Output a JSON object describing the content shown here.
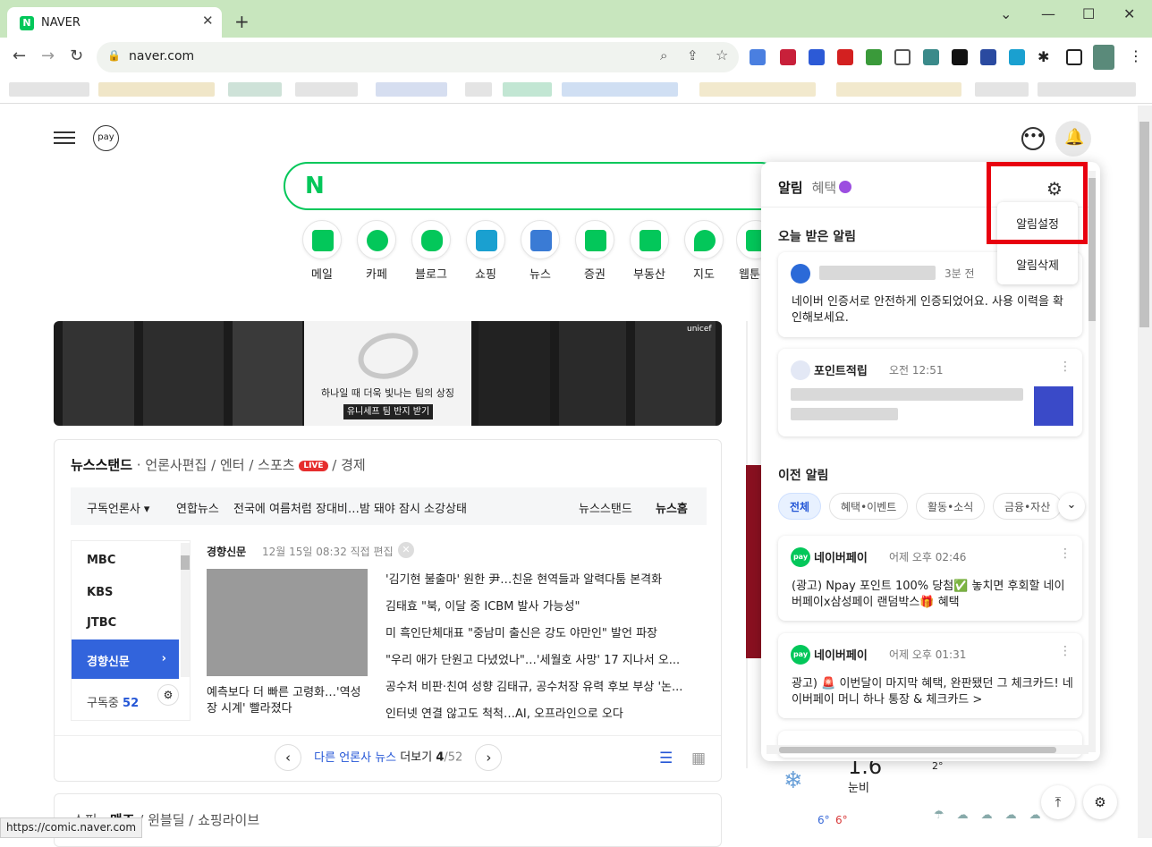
{
  "browser": {
    "tab_title": "NAVER",
    "favicon": "N",
    "url": "naver.com"
  },
  "header": {
    "pay": "pay",
    "talk": "•••",
    "bell": "🔔"
  },
  "search": {
    "logo": "N"
  },
  "services": [
    "메일",
    "카페",
    "블로그",
    "쇼핑",
    "뉴스",
    "증권",
    "부동산",
    "지도",
    "웹툰"
  ],
  "banner": {
    "line1": "하나일 때 더욱 빛나는 팀의 상징",
    "button": "유니세프 팀 반지 받기",
    "brand": "unicef"
  },
  "news": {
    "tabs": [
      "뉴스스탠드",
      "언론사편집",
      "엔터",
      "스포츠",
      "경제"
    ],
    "live": "LIVE",
    "ticker_press": "구독언론사 ▾",
    "ticker_source": "연합뉴스",
    "ticker_text": "전국에 여름처럼 장대비…밤 돼야 잠시 소강상태",
    "ticker_right1": "뉴스스탠드",
    "ticker_right2": "뉴스홈",
    "press_list": [
      "MBC",
      "KBS",
      "JTBC",
      "경향신문"
    ],
    "subscribed_label": "구독중",
    "subscribed_count": "52",
    "article_press": "경향신문",
    "article_time": "12월 15일 08:32 직접 편집",
    "thumb_caption": "예측보다 더 빠른 고령화…'역성장 시계' 빨라졌다",
    "headlines": [
      "'김기현 불출마' 원한 尹…친윤 현역들과 알력다툼 본격화",
      "김태효 \"북, 이달 중 ICBM 발사 가능성\"",
      "미 흑인단체대표 \"중남미 출신은 강도 야만인\" 발언 파장",
      "\"우리 애가 단원고 다녔었나\"…'세월호 사망' 17 지나서 오...",
      "공수처 비판·친여 성향 김태규, 공수처장 유력 후보 부상 '논...",
      "인터넷 연결 않고도 척척…AI, 오프라인으로 오다"
    ],
    "more_link": "다른 언론사 뉴스",
    "more_text": "더보기",
    "page": "4",
    "pages": "/52"
  },
  "shopping": {
    "tabs": [
      "쇼핑",
      "맨즈",
      "윈블딜",
      "쇼핑라이브"
    ]
  },
  "weather": {
    "temp": "1.6",
    "desc": "눈비",
    "low": "6°",
    "high": "6°",
    "mini": "2°"
  },
  "panel": {
    "tab_on": "알림",
    "tab_off": "혜택",
    "today": "오늘 받은 알림",
    "card1_time": "3분 전",
    "card1_body": "네이버 인증서로 안전하게 인증되었어요. 사용 이력을 확인해보세요.",
    "card2_src": "포인트적립",
    "card2_time": "오전 12:51",
    "previous": "이전 알림",
    "chips": [
      "전체",
      "혜택•이벤트",
      "활동•소식",
      "금융•자산"
    ],
    "card3_src": "네이버페이",
    "card3_time": "어제 오후 02:46",
    "card3_body": "(광고) Npay 포인트 100% 당첨✅ 놓치면 후회할 네이버페이x삼성페이 랜덤박스🎁 혜택",
    "card4_src": "네이버페이",
    "card4_time": "어제 오후 01:31",
    "card4_body": "광고) 🚨 이번달이 마지막 혜택, 완판됐던 그 체크카드! 네이버페이 머니 하나 통장 & 체크카드 >",
    "pay_badge": "pay"
  },
  "menu": {
    "item1": "알림설정",
    "item2": "알림삭제"
  },
  "status": "https://comic.naver.com"
}
